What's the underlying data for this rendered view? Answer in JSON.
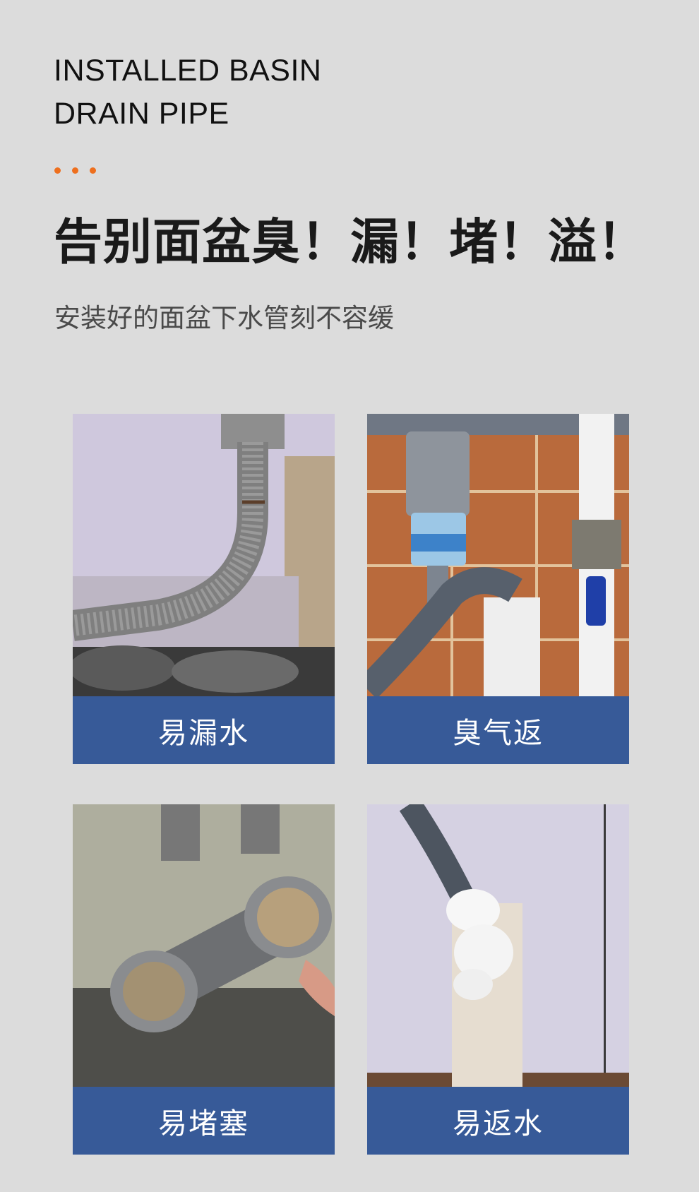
{
  "header": {
    "eyebrow_line1": "INSTALLED BASIN",
    "eyebrow_line2": "DRAIN PIPE",
    "accent_color": "#ee6f1e",
    "headline": "告别面盆臭！漏！堵！溢！",
    "subtitle": "安装好的面盆下水管刻不容缓"
  },
  "problems": [
    {
      "caption": "易漏水",
      "photo": "leaking-corrugated-drain-hose"
    },
    {
      "caption": "臭气返",
      "photo": "drain-hose-into-floor-pipe"
    },
    {
      "caption": "易堵塞",
      "photo": "clogged-pipe-fittings"
    },
    {
      "caption": "易返水",
      "photo": "foam-overflowing-pipe"
    }
  ],
  "colors": {
    "background": "#dcdcdc",
    "caption_bar": "#375a98",
    "caption_text": "#ffffff",
    "headline": "#1a1a1a"
  }
}
